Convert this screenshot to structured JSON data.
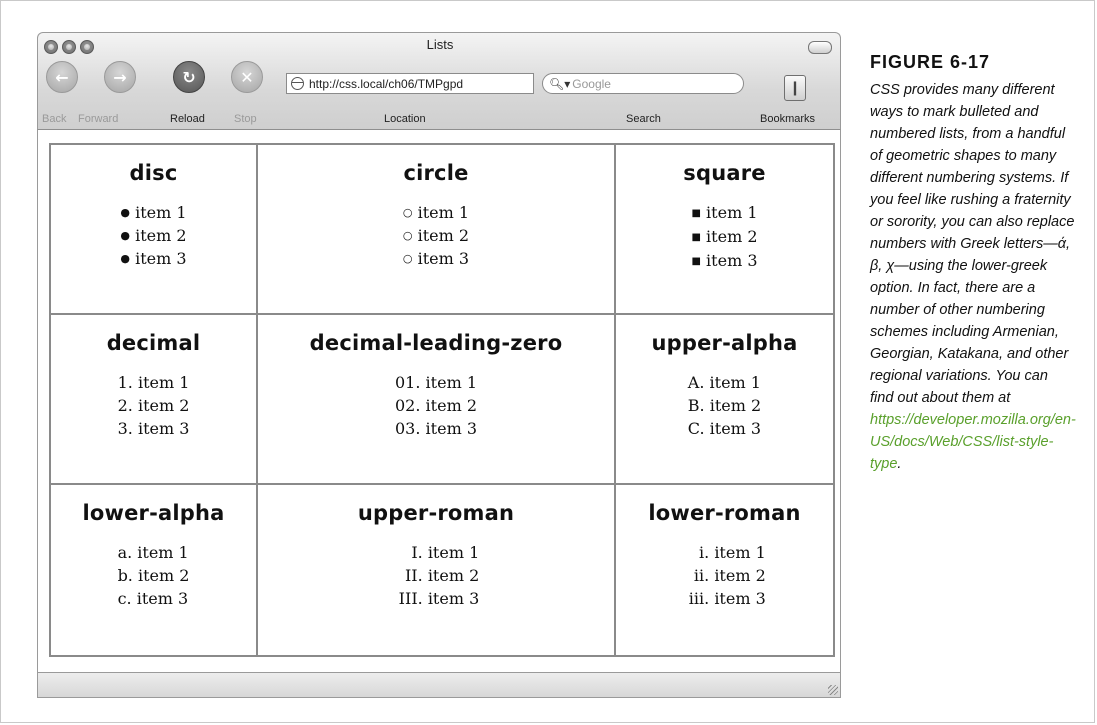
{
  "window": {
    "title": "Lists",
    "toolbar": {
      "back_label": "Back",
      "forward_label": "Forward",
      "reload_label": "Reload",
      "stop_label": "Stop",
      "location_label": "Location",
      "search_label": "Search",
      "bookmarks_label": "Bookmarks",
      "url": "http://css.local/ch06/TMPgpd",
      "search_placeholder": "Google"
    }
  },
  "cells": [
    {
      "heading": "disc",
      "markers": [
        "●",
        "●",
        "●"
      ],
      "items": [
        "item 1",
        "item 2",
        "item 3"
      ]
    },
    {
      "heading": "circle",
      "markers": [
        "○",
        "○",
        "○"
      ],
      "items": [
        "item 1",
        "item 2",
        "item 3"
      ]
    },
    {
      "heading": "square",
      "markers": [
        "■",
        "■",
        "■"
      ],
      "items": [
        "item 1",
        "item 2",
        "item 3"
      ]
    },
    {
      "heading": "decimal",
      "markers": [
        "1.",
        "2.",
        "3."
      ],
      "items": [
        "item 1",
        "item 2",
        "item 3"
      ]
    },
    {
      "heading": "decimal-leading-zero",
      "markers": [
        "01.",
        "02.",
        "03."
      ],
      "items": [
        "item 1",
        "item 2",
        "item 3"
      ]
    },
    {
      "heading": "upper-alpha",
      "markers": [
        "A.",
        "B.",
        "C."
      ],
      "items": [
        "item 1",
        "item 2",
        "item 3"
      ]
    },
    {
      "heading": "lower-alpha",
      "markers": [
        "a.",
        "b.",
        "c."
      ],
      "items": [
        "item 1",
        "item 2",
        "item 3"
      ]
    },
    {
      "heading": "upper-roman",
      "markers": [
        "I.",
        "II.",
        "III."
      ],
      "items": [
        "item 1",
        "item 2",
        "item 3"
      ]
    },
    {
      "heading": "lower-roman",
      "markers": [
        "i.",
        "ii.",
        "iii."
      ],
      "items": [
        "item 1",
        "item 2",
        "item 3"
      ]
    }
  ],
  "caption": {
    "figure_label": "FIGURE 6-17",
    "text": "CSS provides many different ways to mark bulleted and numbered lists, from a handful of geometric shapes to many different numbering systems. If you feel like rushing a fraternity or sorority, you can also replace numbers with Greek letters—ά, β, χ—using the lower-greek option. In fact, there are a number of other numbering schemes including Armenian, Georgian, Katakana, and other regional variations. You can find out about them at",
    "link": "https://developer.mozilla.org/en-US/docs/Web/CSS/list-style-type",
    "trailing": "."
  }
}
